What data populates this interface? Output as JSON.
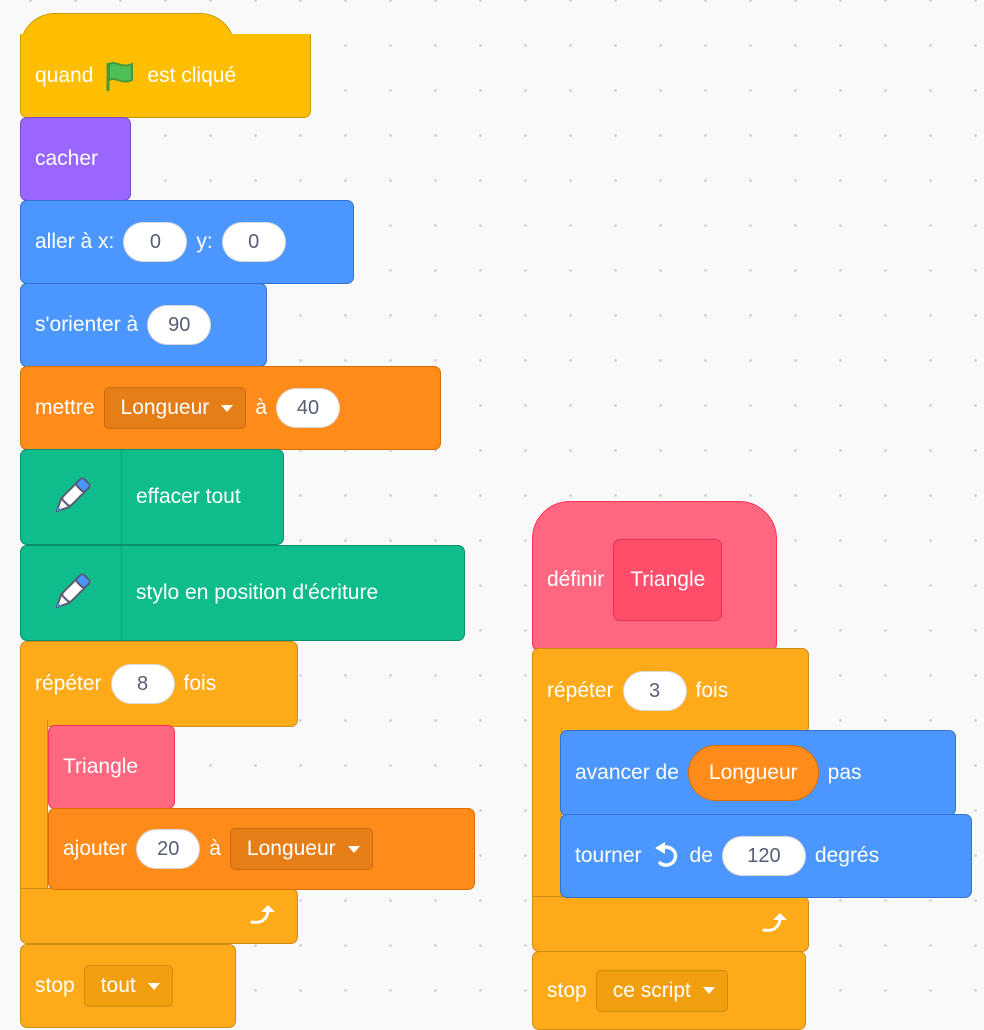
{
  "script1": {
    "hat": {
      "text1": "quand",
      "icon": "green-flag-icon",
      "text2": "est cliqué"
    },
    "hide": "cacher",
    "goto": {
      "label": "aller à x:",
      "x": "0",
      "ylabel": "y:",
      "y": "0"
    },
    "point": {
      "label": "s'orienter à",
      "value": "90"
    },
    "setvar": {
      "label": "mettre",
      "var": "Longueur",
      "to": "à",
      "value": "40"
    },
    "pen_clear": "effacer tout",
    "pen_down": "stylo en position d'écriture",
    "repeat": {
      "label": "répéter",
      "times": "8",
      "suffix": "fois"
    },
    "call_triangle": "Triangle",
    "changevar": {
      "label": "ajouter",
      "value": "20",
      "to": "à",
      "var": "Longueur"
    },
    "stop": {
      "label": "stop",
      "option": "tout"
    }
  },
  "script2": {
    "define": {
      "label": "définir",
      "name": "Triangle"
    },
    "repeat": {
      "label": "répéter",
      "times": "3",
      "suffix": "fois"
    },
    "move": {
      "label": "avancer de",
      "reporter": "Longueur",
      "suffix": "pas"
    },
    "turn": {
      "label": "tourner",
      "icon": "rotate-left-icon",
      "of": "de",
      "value": "120",
      "suffix": "degrés"
    },
    "stop": {
      "label": "stop",
      "option": "ce script"
    }
  },
  "colors": {
    "events": "#ffbf00",
    "looks": "#9966ff",
    "motion": "#4c97ff",
    "variables": "#ff8c1a",
    "pen": "#0fbd8c",
    "control": "#ffab19",
    "my_blocks": "#ff6680"
  }
}
